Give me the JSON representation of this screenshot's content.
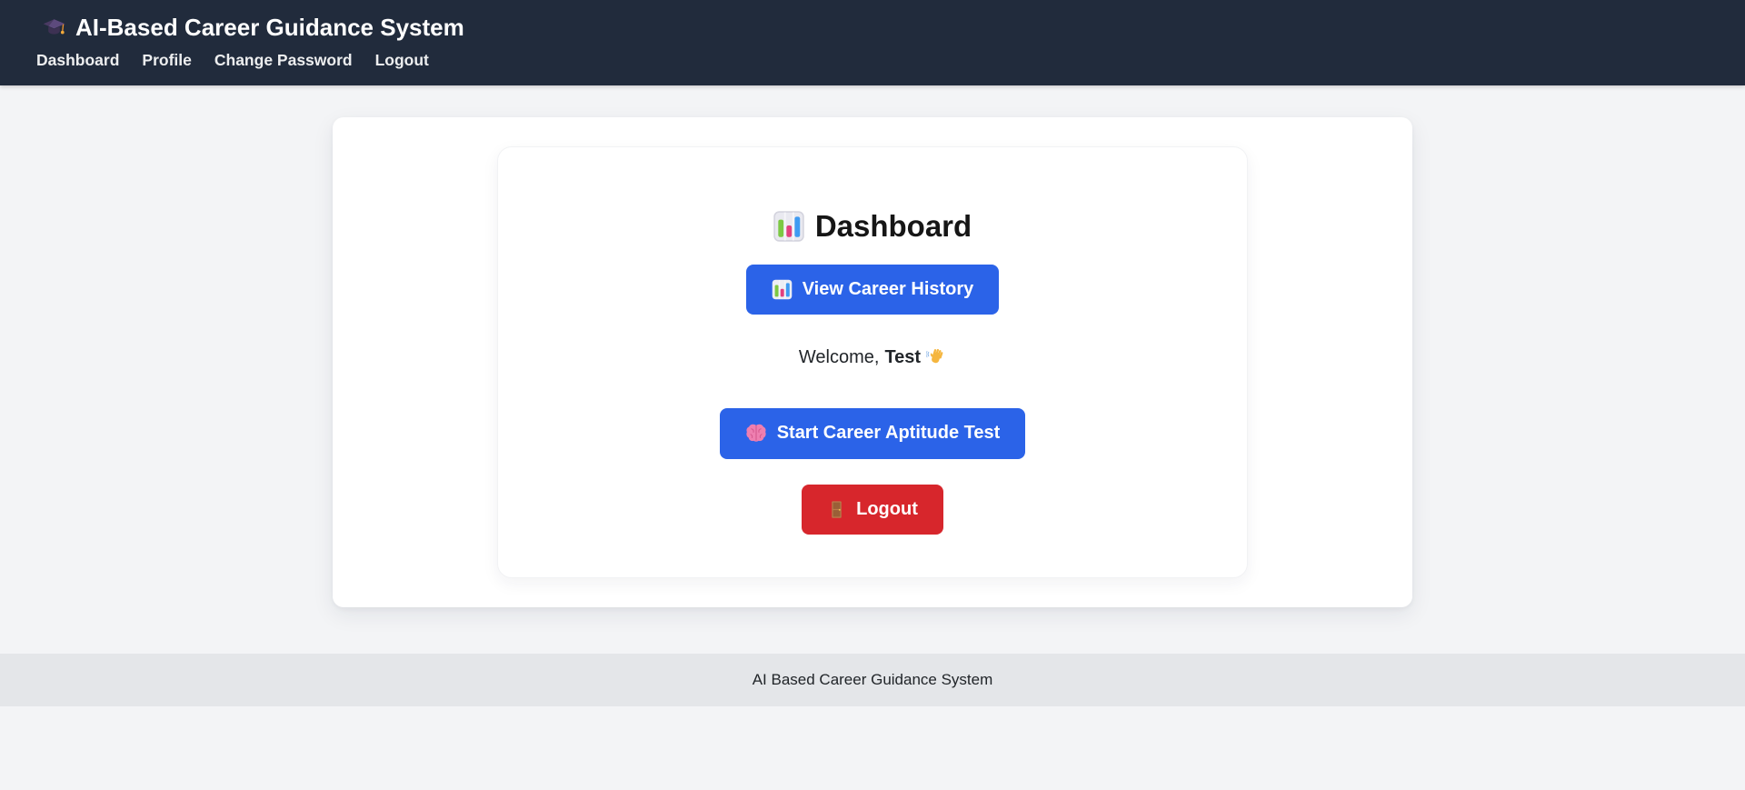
{
  "navbar": {
    "brand_icon": "graduation-cap-icon",
    "brand_title": "AI-Based Career Guidance System",
    "links": [
      {
        "label": "Dashboard"
      },
      {
        "label": "Profile"
      },
      {
        "label": "Change Password"
      },
      {
        "label": "Logout"
      }
    ]
  },
  "dashboard": {
    "heading_icon": "bar-chart-icon",
    "heading": "Dashboard",
    "buttons": {
      "view_history": {
        "icon": "bar-chart-icon",
        "label": "View Career History"
      },
      "start_test": {
        "icon": "brain-icon",
        "label": "Start Career Aptitude Test"
      },
      "logout": {
        "icon": "door-icon",
        "label": "Logout"
      }
    },
    "welcome": {
      "prefix": "Welcome,",
      "username": "Test",
      "icon": "waving-hand-icon"
    }
  },
  "footer": {
    "text": "AI Based Career Guidance System"
  },
  "colors": {
    "navbar_bg": "#212b3c",
    "page_bg": "#f3f4f6",
    "primary_button": "#2b63e8",
    "danger_button": "#d7262c",
    "footer_bg": "#e4e6e9"
  }
}
